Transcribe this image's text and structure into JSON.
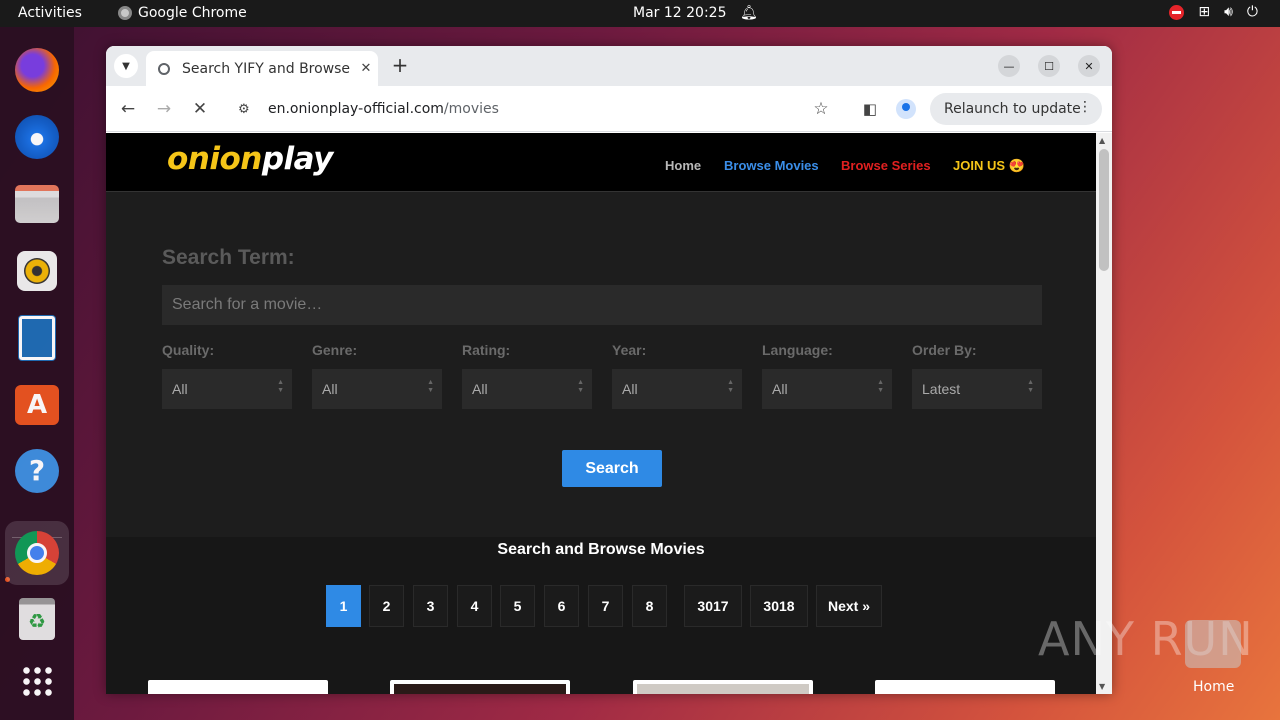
{
  "topbar": {
    "activities": "Activities",
    "app_name": "Google Chrome",
    "clock": "Mar 12  20:25"
  },
  "dock": {
    "items": [
      "Firefox",
      "Thunderbird",
      "Files",
      "Rhythmbox",
      "LibreOffice Impress",
      "App Center",
      "Help",
      "Google Chrome",
      "Trash",
      "Show Apps"
    ]
  },
  "browser": {
    "tab_title": "Search YIFY and Browse",
    "url_host": "en.onionplay-official.com",
    "url_path": "/movies",
    "relaunch_label": "Relaunch to update"
  },
  "site": {
    "logo_part1": "onion",
    "logo_part2": "play",
    "nav": [
      {
        "label": "Home",
        "color": "#b8b8b8"
      },
      {
        "label": "Browse Movies",
        "color": "#3b8ee8"
      },
      {
        "label": "Browse Series",
        "color": "#e02020"
      },
      {
        "label": "JOIN US 😍",
        "color": "#f5c518"
      }
    ]
  },
  "search": {
    "label": "Search Term:",
    "placeholder": "Search for a movie…",
    "filters": [
      {
        "label": "Quality:",
        "value": "All"
      },
      {
        "label": "Genre:",
        "value": "All"
      },
      {
        "label": "Rating:",
        "value": "All"
      },
      {
        "label": "Year:",
        "value": "All"
      },
      {
        "label": "Language:",
        "value": "All"
      },
      {
        "label": "Order By:",
        "value": "Latest"
      }
    ],
    "button": "Search"
  },
  "browse": {
    "title": "Search and Browse Movies",
    "pages": [
      "1",
      "2",
      "3",
      "4",
      "5",
      "6",
      "7",
      "8",
      "3017",
      "3018",
      "Next »"
    ],
    "active_page": "1"
  },
  "desktop": {
    "watermark": "ANY RUN",
    "home_label": "Home"
  }
}
